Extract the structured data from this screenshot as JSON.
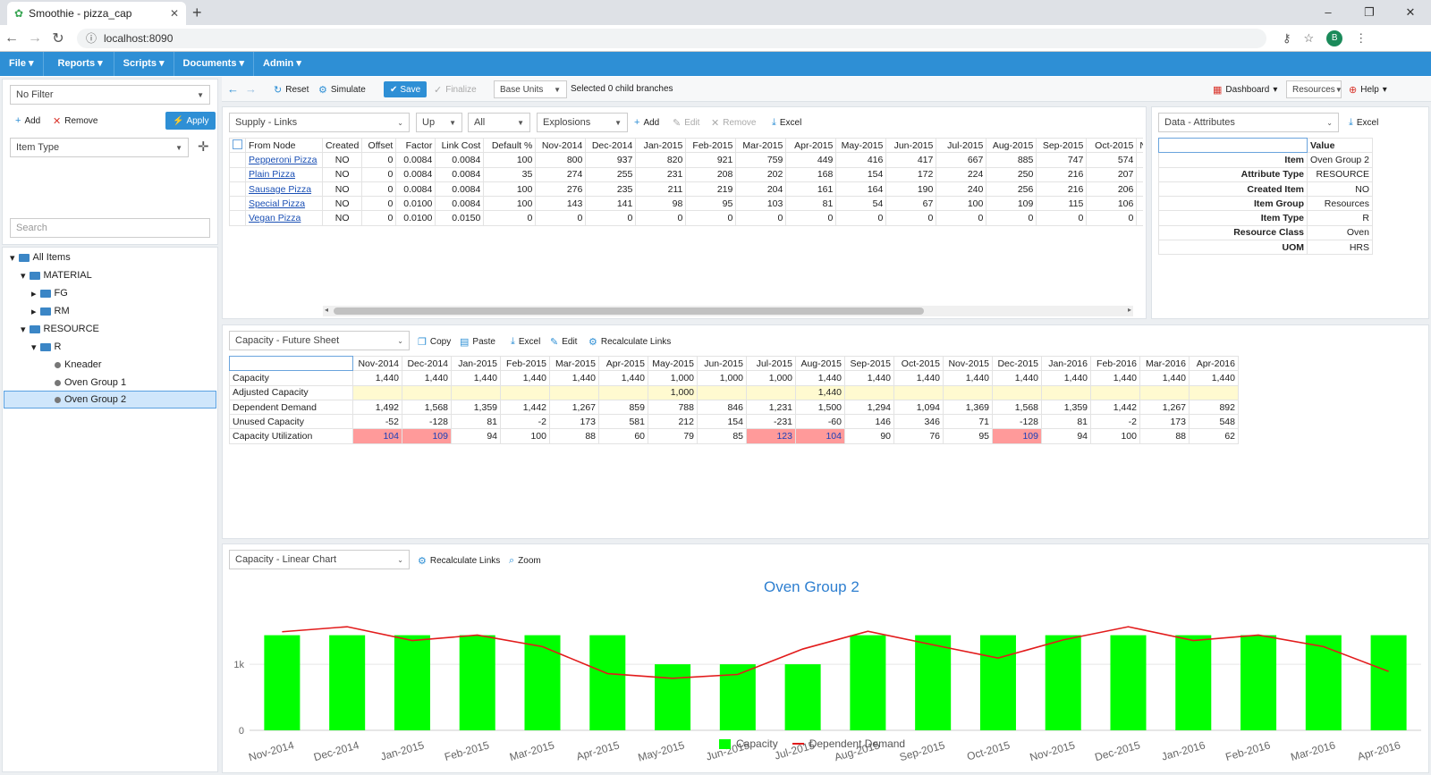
{
  "browser": {
    "tab_title": "Smoothie - pizza_cap",
    "url": "localhost:8090",
    "avatar_letter": "B"
  },
  "menubar": [
    "File",
    "Reports",
    "Scripts",
    "Documents",
    "Admin"
  ],
  "left": {
    "filter": "No Filter",
    "add": "Add",
    "remove": "Remove",
    "apply": "Apply",
    "item_type": "Item Type",
    "search_placeholder": "Search",
    "tree": [
      "All Items",
      "MATERIAL",
      "FG",
      "RM",
      "RESOURCE",
      "R",
      "Kneader",
      "Oven Group 1",
      "Oven Group 2"
    ]
  },
  "toolbar": {
    "reset": "Reset",
    "simulate": "Simulate",
    "save": "Save",
    "finalize": "Finalize",
    "units": "Base Units",
    "status": "Selected 0 child branches",
    "dashboard": "Dashboard",
    "resources": "Resources",
    "help": "Help"
  },
  "supply": {
    "view": "Supply - Links",
    "direction": "Up",
    "scope": "All",
    "mode": "Explosions",
    "add": "Add",
    "edit": "Edit",
    "remove": "Remove",
    "excel": "Excel",
    "headers": [
      "From Node",
      "Created",
      "Offset",
      "Factor",
      "Link Cost",
      "Default %",
      "Nov-2014",
      "Dec-2014",
      "Jan-2015",
      "Feb-2015",
      "Mar-2015",
      "Apr-2015",
      "May-2015",
      "Jun-2015",
      "Jul-2015",
      "Aug-2015",
      "Sep-2015",
      "Oct-2015",
      "N"
    ],
    "rows": [
      [
        "Pepperoni Pizza",
        "NO",
        "0",
        "0.0084",
        "0.0084",
        "100",
        "800",
        "937",
        "820",
        "921",
        "759",
        "449",
        "416",
        "417",
        "667",
        "885",
        "747",
        "574"
      ],
      [
        "Plain Pizza",
        "NO",
        "0",
        "0.0084",
        "0.0084",
        "35",
        "274",
        "255",
        "231",
        "208",
        "202",
        "168",
        "154",
        "172",
        "224",
        "250",
        "216",
        "207"
      ],
      [
        "Sausage Pizza",
        "NO",
        "0",
        "0.0084",
        "0.0084",
        "100",
        "276",
        "235",
        "211",
        "219",
        "204",
        "161",
        "164",
        "190",
        "240",
        "256",
        "216",
        "206"
      ],
      [
        "Special Pizza",
        "NO",
        "0",
        "0.0100",
        "0.0084",
        "100",
        "143",
        "141",
        "98",
        "95",
        "103",
        "81",
        "54",
        "67",
        "100",
        "109",
        "115",
        "106"
      ],
      [
        "Vegan Pizza",
        "NO",
        "0",
        "0.0100",
        "0.0150",
        "0",
        "0",
        "0",
        "0",
        "0",
        "0",
        "0",
        "0",
        "0",
        "0",
        "0",
        "0",
        "0"
      ]
    ]
  },
  "attributes": {
    "view": "Data - Attributes",
    "excel": "Excel",
    "value_header": "Value",
    "rows": [
      [
        "Item",
        "Oven Group 2"
      ],
      [
        "Attribute Type",
        "RESOURCE"
      ],
      [
        "Created Item",
        "NO"
      ],
      [
        "Item Group",
        "Resources"
      ],
      [
        "Item Type",
        "R"
      ],
      [
        "Resource Class",
        "Oven"
      ],
      [
        "UOM",
        "HRS"
      ]
    ]
  },
  "capacity": {
    "view": "Capacity - Future Sheet",
    "copy": "Copy",
    "paste": "Paste",
    "excel": "Excel",
    "edit": "Edit",
    "recalc": "Recalculate Links",
    "months": [
      "Nov-2014",
      "Dec-2014",
      "Jan-2015",
      "Feb-2015",
      "Mar-2015",
      "Apr-2015",
      "May-2015",
      "Jun-2015",
      "Jul-2015",
      "Aug-2015",
      "Sep-2015",
      "Oct-2015",
      "Nov-2015",
      "Dec-2015",
      "Jan-2016",
      "Feb-2016",
      "Mar-2016",
      "Apr-2016"
    ],
    "rows": [
      {
        "label": "Capacity",
        "values": [
          "1,440",
          "1,440",
          "1,440",
          "1,440",
          "1,440",
          "1,440",
          "1,000",
          "1,000",
          "1,000",
          "1,440",
          "1,440",
          "1,440",
          "1,440",
          "1,440",
          "1,440",
          "1,440",
          "1,440",
          "1,440"
        ]
      },
      {
        "label": "Adjusted Capacity",
        "values": [
          "",
          "",
          "",
          "",
          "",
          "",
          "1,000",
          "",
          "",
          "1,440",
          "",
          "",
          "",
          "",
          "",
          "",
          "",
          ""
        ]
      },
      {
        "label": "Dependent Demand",
        "values": [
          "1,492",
          "1,568",
          "1,359",
          "1,442",
          "1,267",
          "859",
          "788",
          "846",
          "1,231",
          "1,500",
          "1,294",
          "1,094",
          "1,369",
          "1,568",
          "1,359",
          "1,442",
          "1,267",
          "892"
        ]
      },
      {
        "label": "Unused Capacity",
        "values": [
          "-52",
          "-128",
          "81",
          "-2",
          "173",
          "581",
          "212",
          "154",
          "-231",
          "-60",
          "146",
          "346",
          "71",
          "-128",
          "81",
          "-2",
          "173",
          "548"
        ]
      },
      {
        "label": "Capacity Utilization",
        "values": [
          "104",
          "109",
          "94",
          "100",
          "88",
          "60",
          "79",
          "85",
          "123",
          "104",
          "90",
          "76",
          "95",
          "109",
          "94",
          "100",
          "88",
          "62"
        ]
      }
    ]
  },
  "chart_panel": {
    "view": "Capacity - Linear Chart",
    "recalc": "Recalculate Links",
    "zoom": "Zoom"
  },
  "chart_data": {
    "type": "bar",
    "title": "Oven Group 2",
    "categories": [
      "Nov-2014",
      "Dec-2014",
      "Jan-2015",
      "Feb-2015",
      "Mar-2015",
      "Apr-2015",
      "May-2015",
      "Jun-2015",
      "Jul-2015",
      "Aug-2015",
      "Sep-2015",
      "Oct-2015",
      "Nov-2015",
      "Dec-2015",
      "Jan-2016",
      "Feb-2016",
      "Mar-2016",
      "Apr-2016"
    ],
    "series": [
      {
        "name": "Capacity",
        "type": "bar",
        "color": "#00ff00",
        "values": [
          1440,
          1440,
          1440,
          1440,
          1440,
          1440,
          1000,
          1000,
          1000,
          1440,
          1440,
          1440,
          1440,
          1440,
          1440,
          1440,
          1440,
          1440
        ]
      },
      {
        "name": "Dependent Demand",
        "type": "line",
        "color": "#e21b1b",
        "values": [
          1492,
          1568,
          1359,
          1442,
          1267,
          859,
          788,
          846,
          1231,
          1500,
          1294,
          1094,
          1369,
          1568,
          1359,
          1442,
          1267,
          892
        ]
      }
    ],
    "yticks": [
      "0",
      "1k"
    ],
    "ylim": [
      0,
      1800
    ],
    "grid": true,
    "legend": "bottom"
  }
}
